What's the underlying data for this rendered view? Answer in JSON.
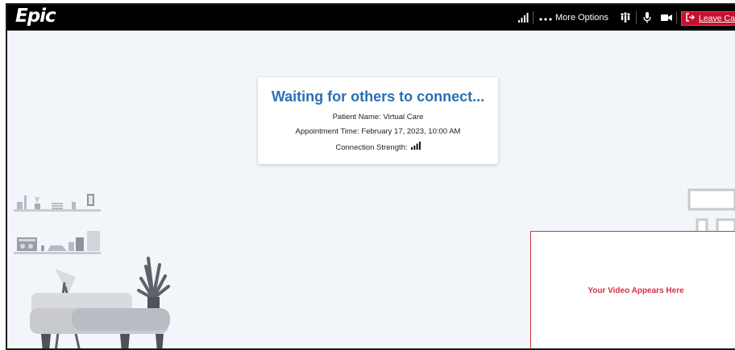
{
  "topbar": {
    "logo": "Epic",
    "more_options": "More Options",
    "leave_call": "Leave Call",
    "icons": [
      "signal-bars-icon",
      "more-dots-icon",
      "participants-icon",
      "microphone-icon",
      "camera-icon",
      "exit-icon"
    ]
  },
  "card": {
    "title": "Waiting for others to connect...",
    "patient_name": "Patient Name: Virtual Care",
    "appointment_time": "Appointment Time: February 17, 2023, 10:00 AM",
    "connection_strength_label": "Connection Strength:"
  },
  "self_view": {
    "label": "Your Video Appears Here"
  },
  "colors": {
    "title_blue": "#2a6fb5",
    "leave_red": "#c8102e",
    "self_view_red": "#d6323f",
    "background": "#f2f6fb"
  }
}
